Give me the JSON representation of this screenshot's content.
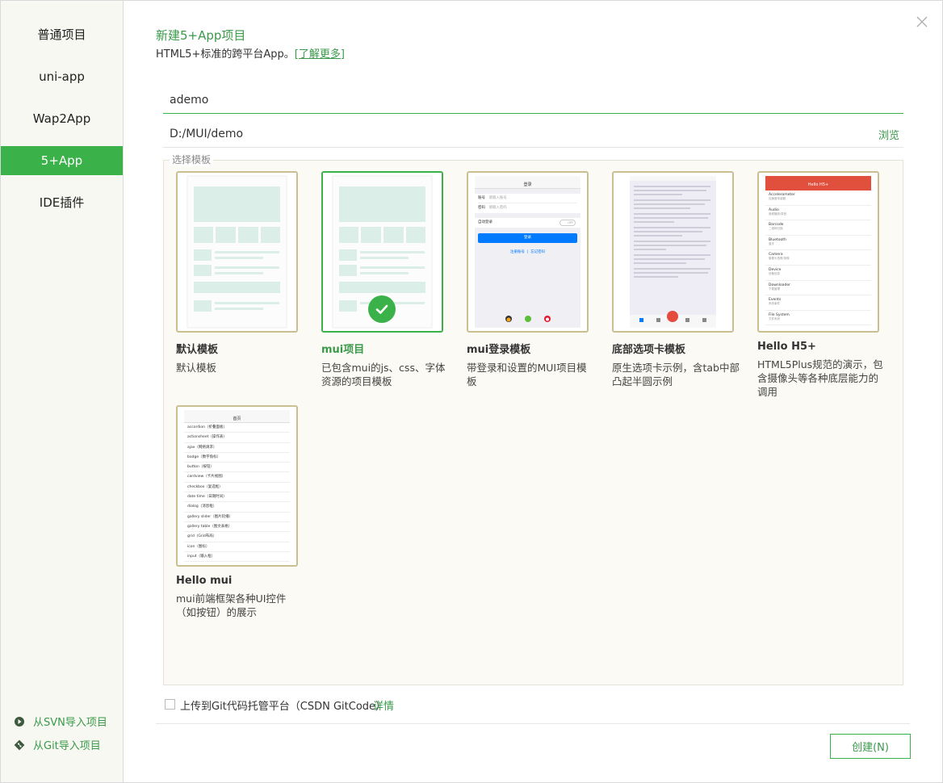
{
  "sidebar": {
    "items": [
      {
        "label": "普通项目"
      },
      {
        "label": "uni-app"
      },
      {
        "label": "Wap2App"
      },
      {
        "label": "5+App"
      },
      {
        "label": "IDE插件"
      }
    ],
    "active_index": 3,
    "import_svn": "从SVN导入项目",
    "import_git": "从Git导入项目"
  },
  "header": {
    "title": "新建5+App项目",
    "subtitle": "HTML5+标准的跨平台App。",
    "learn_more": "[了解更多]"
  },
  "form": {
    "project_name": "ademo",
    "location": "D:/MUI/demo",
    "browse_label": "浏览"
  },
  "templates": {
    "section_label": "选择模板",
    "items": [
      {
        "name": "默认模板",
        "desc": "默认模板"
      },
      {
        "name": "mui项目",
        "desc": "已包含mui的js、css、字体资源的项目模板",
        "selected": true
      },
      {
        "name": "mui登录模板",
        "desc": "带登录和设置的MUI项目模板"
      },
      {
        "name": "底部选项卡模板",
        "desc": "原生选项卡示例，含tab中部凸起半圆示例"
      },
      {
        "name": "Hello H5+",
        "desc": "HTML5Plus规范的演示，包含摄像头等各种底层能力的调用"
      },
      {
        "name": "Hello mui",
        "desc": "mui前端框架各种UI控件（如按钮）的展示"
      }
    ],
    "login_mock": {
      "title": "登录",
      "account": "账号",
      "account_ph": "请输入账号",
      "password": "密码",
      "password_ph": "请输入密码",
      "auto_login": "自动登录",
      "toggle": "OFF",
      "login_btn": "登录",
      "register": "注册账号",
      "forgot": "忘记密码"
    },
    "h5plus_mock": {
      "title": "Hello H5+",
      "rows": [
        {
          "en": "Accelerometer",
          "cn": "加速度传感器"
        },
        {
          "en": "Audio",
          "cn": "音频播放/录音"
        },
        {
          "en": "Barcode",
          "cn": "二维码扫描"
        },
        {
          "en": "Bluetooth",
          "cn": "蓝牙"
        },
        {
          "en": "Camera",
          "cn": "摄像头拍照/录像"
        },
        {
          "en": "Device",
          "cn": "设备信息"
        },
        {
          "en": "Downloader",
          "cn": "下载管理"
        },
        {
          "en": "Events",
          "cn": "系统事件"
        },
        {
          "en": "File System",
          "cn": "文件系统"
        }
      ]
    },
    "hellomui_mock": {
      "title": "首页",
      "rows": [
        "accordion（折叠面板）",
        "actionsheet（操作表）",
        "ajax（网络请求）",
        "badge（数字角标）",
        "button（按钮）",
        "cardview（卡片视图）",
        "checkbox（复选框）",
        "date time（日期时间）",
        "dialog（消息框）",
        "gallery slider（图片轮播）",
        "gallery table（图文表格）",
        "grid（Grid布局）",
        "icon（图标）",
        "input（输入框）"
      ]
    }
  },
  "footer": {
    "git_label": "上传到Git代码托管平台（CSDN GitCode）",
    "git_detail": "详情",
    "create_label": "创建(N)"
  },
  "colors": {
    "accent": "#3bb149",
    "thumb_border": "#c9bf90",
    "sidebar_bg": "#f7f8f1"
  }
}
